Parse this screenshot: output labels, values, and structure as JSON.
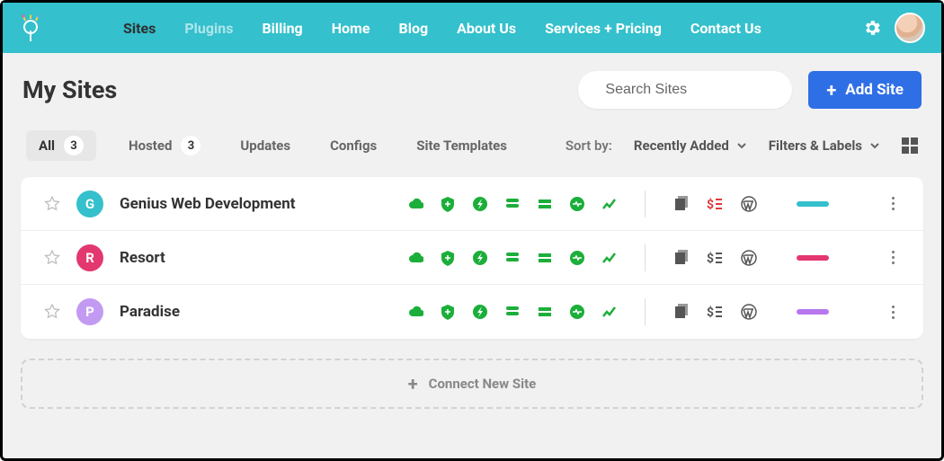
{
  "nav": {
    "items": [
      {
        "label": "Sites",
        "style": "dark"
      },
      {
        "label": "Plugins",
        "style": "faded"
      },
      {
        "label": "Billing",
        "style": "normal"
      },
      {
        "label": "Home",
        "style": "normal"
      },
      {
        "label": "Blog",
        "style": "normal"
      },
      {
        "label": "About Us",
        "style": "normal"
      },
      {
        "label": "Services  + Pricing",
        "style": "normal"
      },
      {
        "label": "Contact Us",
        "style": "normal"
      }
    ]
  },
  "page": {
    "title": "My Sites"
  },
  "search": {
    "placeholder": "Search Sites"
  },
  "add_button": {
    "label": "Add Site"
  },
  "tabs": {
    "all": {
      "label": "All",
      "count": "3"
    },
    "hosted": {
      "label": "Hosted",
      "count": "3"
    },
    "updates": {
      "label": "Updates"
    },
    "configs": {
      "label": "Configs"
    },
    "templates": {
      "label": "Site Templates"
    }
  },
  "sort": {
    "label": "Sort by:",
    "value": "Recently Added"
  },
  "filters": {
    "label": "Filters & Labels"
  },
  "sites": [
    {
      "initial": "G",
      "name": "Genius Web Development",
      "avatar_color": "#34c0cc",
      "pill_color": "#34c0cc",
      "price_red": true
    },
    {
      "initial": "R",
      "name": "Resort",
      "avatar_color": "#e33770",
      "pill_color": "#e33770",
      "price_red": false
    },
    {
      "initial": "P",
      "name": "Paradise",
      "avatar_color": "#c29af2",
      "pill_color": "#b877ed",
      "price_red": false
    }
  ],
  "connect": {
    "label": "Connect New Site"
  }
}
